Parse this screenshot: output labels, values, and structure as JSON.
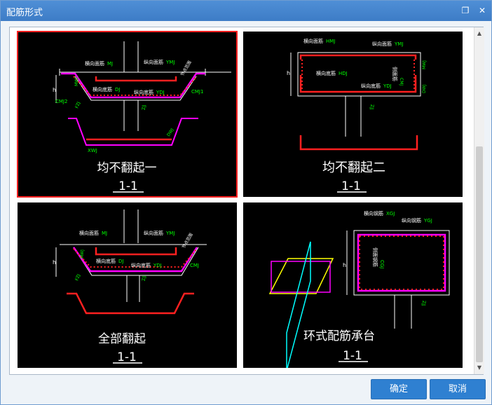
{
  "window": {
    "title": "配筋形式",
    "restore_glyph": "❐",
    "close_glyph": "✕"
  },
  "panels": [
    {
      "caption": "均不翻起一",
      "section": "1-1",
      "labels": {
        "hmj": "横向面筋",
        "hmj_code": "MJ",
        "zmj": "纵向面筋",
        "zmj_code": "YMJ",
        "hdj": "横向底筋",
        "hdj_code": "DJ",
        "zdj": "纵向底筋",
        "zdj_code": "YDJ",
        "mwj": "MWJ",
        "cmj1": "CMJ1",
        "cmj2": "CMJ2",
        "fzj": "FZJ",
        "zjj": "ZJJ",
        "xwj": "XWJ",
        "dwj": "DWJ",
        "h": "h",
        "side": "节点范围"
      }
    },
    {
      "caption": "均不翻起二",
      "section": "1-1",
      "labels": {
        "hmj": "横向面筋",
        "hmj_code": "HMJ",
        "zmj": "纵向面筋",
        "zmj_code": "YMJ",
        "hdj": "横向底筋",
        "hdj_code": "HDJ",
        "zdj": "纵向底筋",
        "zdj_code": "YDJ",
        "side": "侧面筋",
        "cmj": "CMJ",
        "mwj": "MWJ",
        "dwj": "DWJ",
        "zjj": "ZJJ",
        "h": "h"
      }
    },
    {
      "caption": "全部翻起",
      "section": "1-1",
      "labels": {
        "hmj": "横向面筋",
        "hmj_code": "MJ",
        "zmj": "纵向面筋",
        "zmj_code": "YMJ",
        "hdj": "横向底筋",
        "hdj_code": "DJ",
        "zdj": "纵向底筋",
        "zdj_code": "YDJ",
        "mwj": "MWJ",
        "cmj": "CMJ",
        "fzj": "FZJ",
        "zjj": "ZJJ",
        "h": "h",
        "side": "节点范围"
      }
    },
    {
      "caption": "环式配筋承台",
      "section": "1-1",
      "labels": {
        "hxg": "横向钢筋",
        "hxg_code": "XGJ",
        "zxg": "纵向钢筋",
        "zxg_code": "YGJ",
        "side": "侧面钢筋",
        "cgj": "CGJ",
        "zjj": "ZJJ",
        "h": "h"
      }
    }
  ],
  "buttons": {
    "ok": "确定",
    "cancel": "取消"
  },
  "colors": {
    "accent": "#2f80d1",
    "rebar_red": "#ff2020",
    "rebar_magenta": "#ff00ff",
    "label_green": "#00ff00",
    "selected": "#ff2020"
  }
}
